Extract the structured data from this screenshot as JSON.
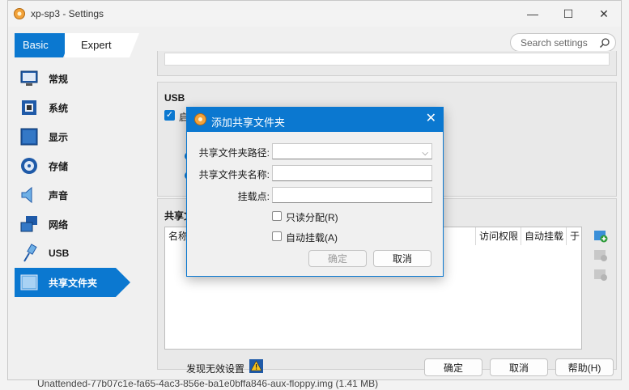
{
  "window": {
    "title": "xp-sp3 - Settings",
    "minimize": "—",
    "maximize": "☐",
    "close": "✕"
  },
  "mode_tabs": {
    "basic": "Basic",
    "expert": "Expert"
  },
  "search": {
    "placeholder": "Search settings"
  },
  "sidebar": {
    "items": [
      {
        "label": "常规",
        "icon": "monitor-icon"
      },
      {
        "label": "系统",
        "icon": "chip-icon"
      },
      {
        "label": "显示",
        "icon": "display-icon"
      },
      {
        "label": "存储",
        "icon": "disk-icon"
      },
      {
        "label": "声音",
        "icon": "speaker-icon"
      },
      {
        "label": "网络",
        "icon": "network-icon"
      },
      {
        "label": "USB",
        "icon": "usb-icon"
      },
      {
        "label": "共享文件夹",
        "icon": "folder-icon",
        "active": true
      }
    ]
  },
  "usb": {
    "title": "USB",
    "enable_label": "启"
  },
  "shared": {
    "title": "共享文",
    "columns": [
      "名称",
      "访问权限",
      "自动挂载",
      "于"
    ]
  },
  "footer": {
    "invalid_settings": "发现无效设置",
    "ok": "确定",
    "cancel": "取消",
    "help": "帮助(H)"
  },
  "dialog": {
    "title": "添加共享文件夹",
    "path_label": "共享文件夹路径:",
    "path_value": "",
    "name_label": "共享文件夹名称:",
    "name_value": "",
    "mount_label": "挂载点:",
    "mount_value": "",
    "readonly_label": "只读分配(R)",
    "readonly_checked": false,
    "automount_label": "自动挂载(A)",
    "automount_checked": false,
    "ok": "确定",
    "cancel": "取消"
  },
  "background": {
    "bottom_text": "Unattended-77b07c1e-fa65-4ac3-856e-ba1e0bffa846-aux-floppy.img (1.41 MB)"
  },
  "colors": {
    "accent": "#0b78d0",
    "window_bg": "#f0f0f0"
  }
}
